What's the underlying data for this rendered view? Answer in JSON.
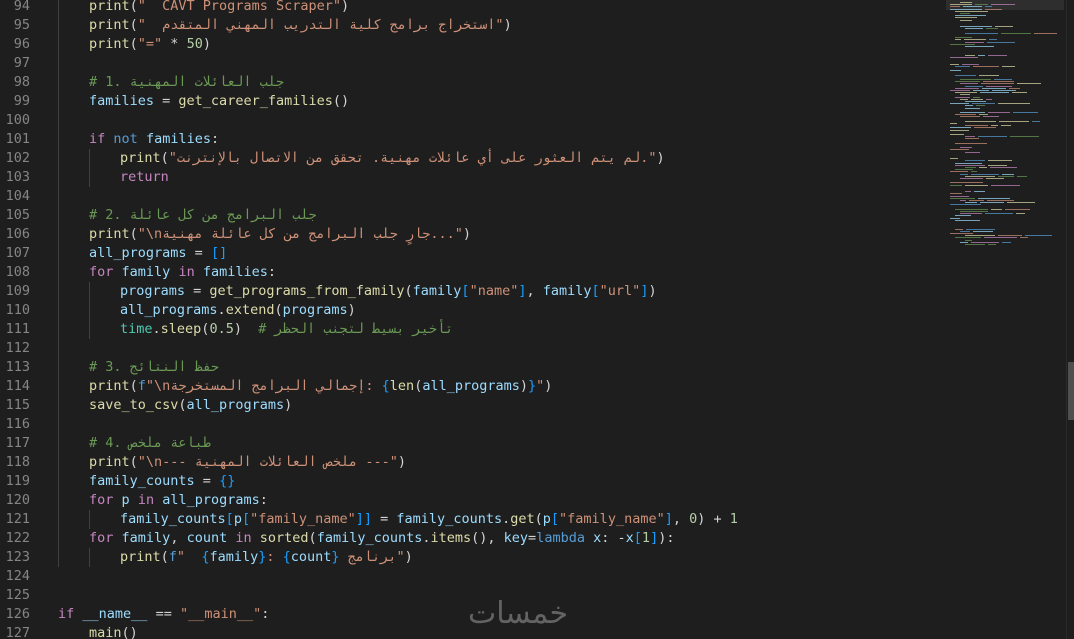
{
  "colors": {
    "background": "#1e1e1e",
    "line_number": "#858585",
    "keyword": "#569cd6",
    "control": "#c586c0",
    "function": "#dcdcaa",
    "variable": "#9cdcfe",
    "string": "#ce9178",
    "number": "#b5cea8",
    "comment": "#6a9955"
  },
  "watermark": "خمسات",
  "lines": [
    {
      "n": "94",
      "indent": 1,
      "tokens": [
        [
          "fn",
          "print"
        ],
        [
          "op",
          "("
        ],
        [
          "str",
          "\"  CAVT Programs Scraper\""
        ],
        [
          "op",
          ")"
        ]
      ]
    },
    {
      "n": "95",
      "indent": 1,
      "tokens": [
        [
          "fn",
          "print"
        ],
        [
          "op",
          "("
        ],
        [
          "str",
          "\"  استخراج برامج كلية التدريب المهني المتقدم\""
        ],
        [
          "op",
          ")"
        ]
      ]
    },
    {
      "n": "96",
      "indent": 1,
      "tokens": [
        [
          "fn",
          "print"
        ],
        [
          "op",
          "("
        ],
        [
          "str",
          "\"=\""
        ],
        [
          "op",
          " * "
        ],
        [
          "num",
          "50"
        ],
        [
          "op",
          ")"
        ]
      ]
    },
    {
      "n": "97",
      "indent": 1,
      "tokens": []
    },
    {
      "n": "98",
      "indent": 1,
      "tokens": [
        [
          "cmt",
          "# 1. جلب العائلات المهنية"
        ]
      ]
    },
    {
      "n": "99",
      "indent": 1,
      "tokens": [
        [
          "var",
          "families"
        ],
        [
          "op",
          " = "
        ],
        [
          "fn",
          "get_career_families"
        ],
        [
          "op",
          "()"
        ]
      ]
    },
    {
      "n": "100",
      "indent": 1,
      "tokens": []
    },
    {
      "n": "101",
      "indent": 1,
      "tokens": [
        [
          "ctrl",
          "if"
        ],
        [
          "op",
          " "
        ],
        [
          "kw",
          "not"
        ],
        [
          "op",
          " "
        ],
        [
          "var",
          "families"
        ],
        [
          "op",
          ":"
        ]
      ]
    },
    {
      "n": "102",
      "indent": 2,
      "tokens": [
        [
          "fn",
          "print"
        ],
        [
          "op",
          "("
        ],
        [
          "str",
          "\"لم يتم العثور على أي عائلات مهنية. تحقق من الاتصال بالإنترنت.\""
        ],
        [
          "op",
          ")"
        ]
      ]
    },
    {
      "n": "103",
      "indent": 2,
      "tokens": [
        [
          "ctrl",
          "return"
        ]
      ]
    },
    {
      "n": "104",
      "indent": 1,
      "tokens": []
    },
    {
      "n": "105",
      "indent": 1,
      "tokens": [
        [
          "cmt",
          "# 2. جلب البرامج من كل عائلة"
        ]
      ]
    },
    {
      "n": "106",
      "indent": 1,
      "tokens": [
        [
          "fn",
          "print"
        ],
        [
          "op",
          "("
        ],
        [
          "str",
          "\"\\nجارٍ جلب البرامج من كل عائلة مهنية...\""
        ],
        [
          "op",
          ")"
        ]
      ]
    },
    {
      "n": "107",
      "indent": 1,
      "tokens": [
        [
          "var",
          "all_programs"
        ],
        [
          "op",
          " = "
        ],
        [
          "brace",
          "[]"
        ]
      ]
    },
    {
      "n": "108",
      "indent": 1,
      "tokens": [
        [
          "ctrl",
          "for"
        ],
        [
          "op",
          " "
        ],
        [
          "var",
          "family"
        ],
        [
          "op",
          " "
        ],
        [
          "ctrl",
          "in"
        ],
        [
          "op",
          " "
        ],
        [
          "var",
          "families"
        ],
        [
          "op",
          ":"
        ]
      ]
    },
    {
      "n": "109",
      "indent": 2,
      "tokens": [
        [
          "var",
          "programs"
        ],
        [
          "op",
          " = "
        ],
        [
          "fn",
          "get_programs_from_family"
        ],
        [
          "op",
          "("
        ],
        [
          "var",
          "family"
        ],
        [
          "brace",
          "["
        ],
        [
          "str",
          "\"name\""
        ],
        [
          "brace",
          "]"
        ],
        [
          "op",
          ", "
        ],
        [
          "var",
          "family"
        ],
        [
          "brace",
          "["
        ],
        [
          "str",
          "\"url\""
        ],
        [
          "brace",
          "]"
        ],
        [
          "op",
          ")"
        ]
      ]
    },
    {
      "n": "110",
      "indent": 2,
      "tokens": [
        [
          "var",
          "all_programs"
        ],
        [
          "op",
          "."
        ],
        [
          "fn",
          "extend"
        ],
        [
          "op",
          "("
        ],
        [
          "var",
          "programs"
        ],
        [
          "op",
          ")"
        ]
      ]
    },
    {
      "n": "111",
      "indent": 2,
      "tokens": [
        [
          "cls",
          "time"
        ],
        [
          "op",
          "."
        ],
        [
          "fn",
          "sleep"
        ],
        [
          "op",
          "("
        ],
        [
          "num",
          "0.5"
        ],
        [
          "op",
          ")  "
        ],
        [
          "cmt",
          "# تأخير بسيط لتجنب الحظر"
        ]
      ]
    },
    {
      "n": "112",
      "indent": 1,
      "tokens": []
    },
    {
      "n": "113",
      "indent": 1,
      "tokens": [
        [
          "cmt",
          "# 3. حفظ النتائج"
        ]
      ]
    },
    {
      "n": "114",
      "indent": 1,
      "tokens": [
        [
          "fn",
          "print"
        ],
        [
          "op",
          "("
        ],
        [
          "kw",
          "f"
        ],
        [
          "str",
          "\"\\nإجمالي البرامج المستخرجة: "
        ],
        [
          "brace",
          "{"
        ],
        [
          "fn",
          "len"
        ],
        [
          "op",
          "("
        ],
        [
          "var",
          "all_programs"
        ],
        [
          "op",
          ")"
        ],
        [
          "brace",
          "}"
        ],
        [
          "str",
          "\""
        ],
        [
          "op",
          ")"
        ]
      ]
    },
    {
      "n": "115",
      "indent": 1,
      "tokens": [
        [
          "fn",
          "save_to_csv"
        ],
        [
          "op",
          "("
        ],
        [
          "var",
          "all_programs"
        ],
        [
          "op",
          ")"
        ]
      ]
    },
    {
      "n": "116",
      "indent": 1,
      "tokens": []
    },
    {
      "n": "117",
      "indent": 1,
      "tokens": [
        [
          "cmt",
          "# 4. طباعة ملخص"
        ]
      ]
    },
    {
      "n": "118",
      "indent": 1,
      "tokens": [
        [
          "fn",
          "print"
        ],
        [
          "op",
          "("
        ],
        [
          "str",
          "\"\\n--- ملخص العائلات المهنية ---\""
        ],
        [
          "op",
          ")"
        ]
      ]
    },
    {
      "n": "119",
      "indent": 1,
      "tokens": [
        [
          "var",
          "family_counts"
        ],
        [
          "op",
          " = "
        ],
        [
          "brace",
          "{}"
        ]
      ]
    },
    {
      "n": "120",
      "indent": 1,
      "tokens": [
        [
          "ctrl",
          "for"
        ],
        [
          "op",
          " "
        ],
        [
          "var",
          "p"
        ],
        [
          "op",
          " "
        ],
        [
          "ctrl",
          "in"
        ],
        [
          "op",
          " "
        ],
        [
          "var",
          "all_programs"
        ],
        [
          "op",
          ":"
        ]
      ]
    },
    {
      "n": "121",
      "indent": 2,
      "tokens": [
        [
          "var",
          "family_counts"
        ],
        [
          "brace",
          "["
        ],
        [
          "var",
          "p"
        ],
        [
          "brace",
          "["
        ],
        [
          "str",
          "\"family_name\""
        ],
        [
          "brace",
          "]]"
        ],
        [
          "op",
          " = "
        ],
        [
          "var",
          "family_counts"
        ],
        [
          "op",
          "."
        ],
        [
          "fn",
          "get"
        ],
        [
          "op",
          "("
        ],
        [
          "var",
          "p"
        ],
        [
          "brace",
          "["
        ],
        [
          "str",
          "\"family_name\""
        ],
        [
          "brace",
          "]"
        ],
        [
          "op",
          ", "
        ],
        [
          "num",
          "0"
        ],
        [
          "op",
          ") + "
        ],
        [
          "num",
          "1"
        ]
      ]
    },
    {
      "n": "122",
      "indent": 1,
      "tokens": [
        [
          "ctrl",
          "for"
        ],
        [
          "op",
          " "
        ],
        [
          "var",
          "family"
        ],
        [
          "op",
          ", "
        ],
        [
          "var",
          "count"
        ],
        [
          "op",
          " "
        ],
        [
          "ctrl",
          "in"
        ],
        [
          "op",
          " "
        ],
        [
          "fn",
          "sorted"
        ],
        [
          "op",
          "("
        ],
        [
          "var",
          "family_counts"
        ],
        [
          "op",
          "."
        ],
        [
          "fn",
          "items"
        ],
        [
          "op",
          "(), "
        ],
        [
          "var",
          "key"
        ],
        [
          "op",
          "="
        ],
        [
          "kw",
          "lambda"
        ],
        [
          "op",
          " "
        ],
        [
          "var",
          "x"
        ],
        [
          "op",
          ": -"
        ],
        [
          "var",
          "x"
        ],
        [
          "brace",
          "["
        ],
        [
          "num",
          "1"
        ],
        [
          "brace",
          "]"
        ],
        [
          "op",
          "):"
        ]
      ]
    },
    {
      "n": "123",
      "indent": 2,
      "tokens": [
        [
          "fn",
          "print"
        ],
        [
          "op",
          "("
        ],
        [
          "kw",
          "f"
        ],
        [
          "str",
          "\"  "
        ],
        [
          "brace",
          "{"
        ],
        [
          "var",
          "family"
        ],
        [
          "brace",
          "}"
        ],
        [
          "str",
          ": "
        ],
        [
          "brace",
          "{"
        ],
        [
          "var",
          "count"
        ],
        [
          "brace",
          "}"
        ],
        [
          "str",
          " برنامج\""
        ],
        [
          "op",
          ")"
        ]
      ]
    },
    {
      "n": "124",
      "indent": 0,
      "tokens": []
    },
    {
      "n": "125",
      "indent": 0,
      "tokens": []
    },
    {
      "n": "126",
      "indent": 0,
      "tokens": [
        [
          "ctrl",
          "if"
        ],
        [
          "op",
          " "
        ],
        [
          "var",
          "__name__"
        ],
        [
          "op",
          " == "
        ],
        [
          "str",
          "\"__main__\""
        ],
        [
          "op",
          ":"
        ]
      ]
    },
    {
      "n": "127",
      "indent": 1,
      "tokens": [
        [
          "fn",
          "main"
        ],
        [
          "op",
          "()"
        ]
      ]
    }
  ]
}
